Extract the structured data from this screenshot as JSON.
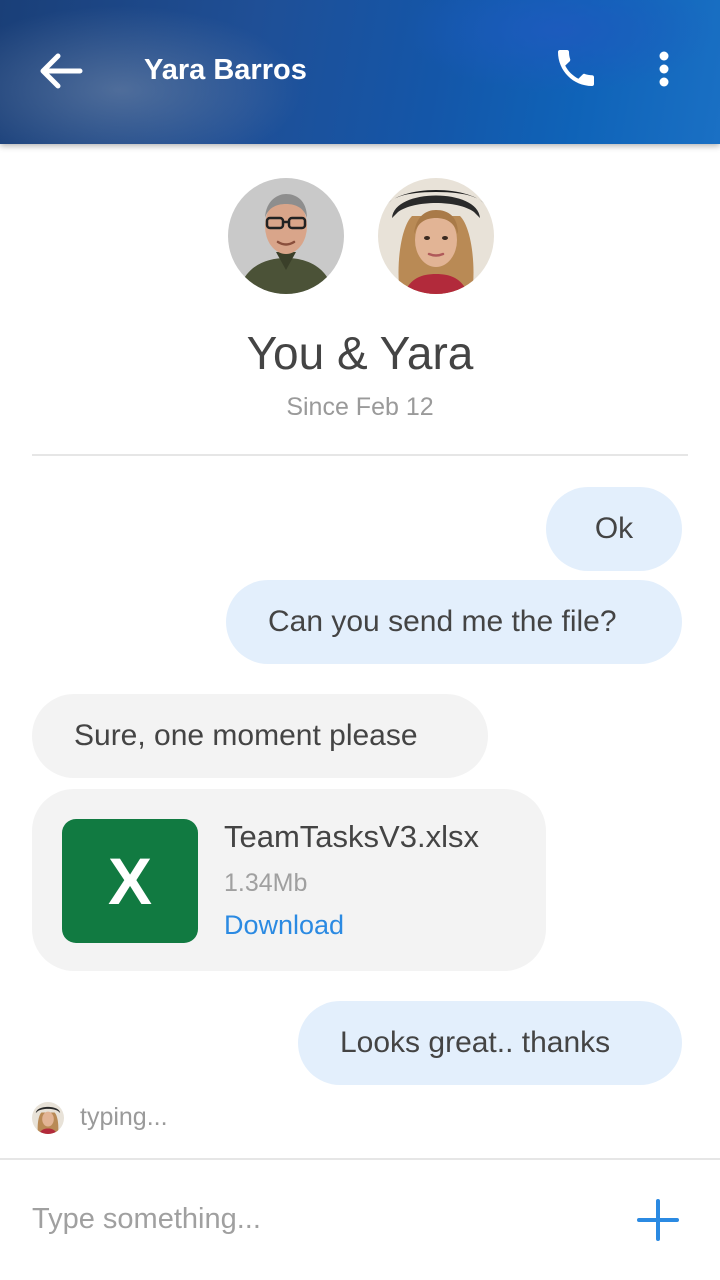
{
  "header": {
    "title": "Yara Barros",
    "back_icon": "arrow-left-icon",
    "call_icon": "phone-icon",
    "more_icon": "more-vertical-icon"
  },
  "conversation": {
    "title": "You & Yara",
    "subtitle": "Since Feb 12"
  },
  "messages": [
    {
      "direction": "outgoing",
      "text": "Ok"
    },
    {
      "direction": "outgoing",
      "text": "Can you send me the file?"
    },
    {
      "direction": "incoming",
      "text": "Sure, one moment please"
    },
    {
      "direction": "incoming",
      "type": "file",
      "file": {
        "icon_letter": "X",
        "name": "TeamTasksV3.xlsx",
        "size": "1.34Mb",
        "action": "Download"
      }
    },
    {
      "direction": "outgoing",
      "text": "Looks great.. thanks"
    }
  ],
  "typing": {
    "text": "typing..."
  },
  "composer": {
    "placeholder": "Type something...",
    "add_icon": "plus-icon"
  },
  "colors": {
    "header_blue": "#1456a8",
    "outgoing_bubble": "#e3effc",
    "incoming_bubble": "#f3f3f3",
    "excel_green": "#117a41",
    "link_blue": "#2b8ae2",
    "add_button_blue": "#2b8ae2"
  }
}
